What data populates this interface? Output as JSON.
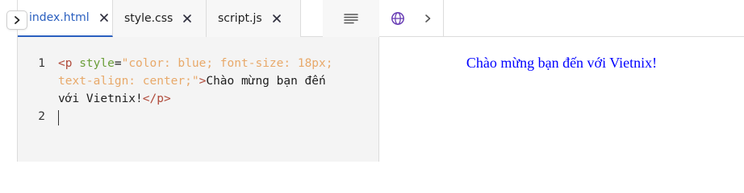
{
  "tabs": [
    {
      "label": "index.html",
      "active": true
    },
    {
      "label": "style.css",
      "active": false
    },
    {
      "label": "script.js",
      "active": false
    }
  ],
  "icons": {
    "toggle": "chevron-right-icon",
    "close": "close-icon",
    "format": "format-lines-icon",
    "globe": "globe-icon",
    "forward": "chevron-right-icon"
  },
  "editor": {
    "line_numbers": [
      "1",
      "2"
    ],
    "line1": {
      "tag_open": "<p",
      "attr": " style",
      "eq": "=",
      "str1": "\"color: blue; font-size: 18px;",
      "str2": "text-align: center;\"",
      "close_bracket": ">",
      "text1": "Chào mừng bạn đến",
      "text2": "với Vietnix!",
      "tag_close": "</p>"
    }
  },
  "preview": {
    "text": "Chào mừng bạn đến với Vietnix!"
  },
  "colors": {
    "active_tab": "#2a5fbf",
    "preview_text": "#0000ff",
    "tag": "#b04a3a",
    "attr": "#6b9e3a",
    "string": "#e8a96a",
    "globe": "#6a3fb5"
  }
}
